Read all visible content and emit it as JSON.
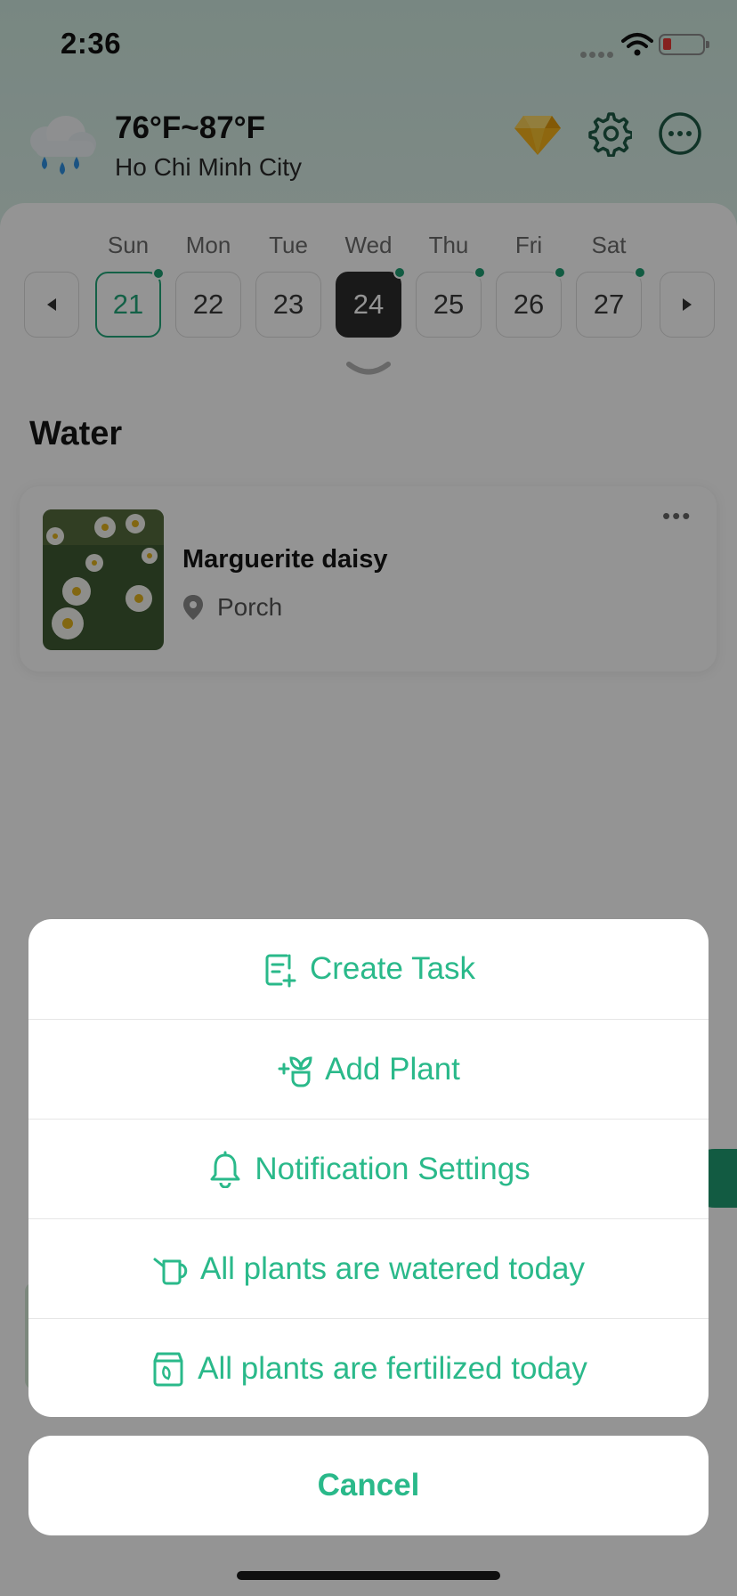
{
  "status_bar": {
    "time": "2:36"
  },
  "weather": {
    "temperature": "76°F~87°F",
    "city": "Ho Chi Minh City",
    "icon": "rain-cloud-icon"
  },
  "header_icons": [
    "premium-gem-icon",
    "settings-gear-icon",
    "more-options-icon"
  ],
  "calendar": {
    "days": [
      {
        "label": "Sun",
        "date": "21",
        "has_task": true,
        "state": "selected"
      },
      {
        "label": "Mon",
        "date": "22",
        "has_task": false,
        "state": "normal"
      },
      {
        "label": "Tue",
        "date": "23",
        "has_task": false,
        "state": "normal"
      },
      {
        "label": "Wed",
        "date": "24",
        "has_task": true,
        "state": "today"
      },
      {
        "label": "Thu",
        "date": "25",
        "has_task": true,
        "state": "normal"
      },
      {
        "label": "Fri",
        "date": "26",
        "has_task": true,
        "state": "normal"
      },
      {
        "label": "Sat",
        "date": "27",
        "has_task": true,
        "state": "normal"
      }
    ]
  },
  "section": {
    "title": "Water"
  },
  "plant_card": {
    "name": "Marguerite daisy",
    "location": "Porch",
    "more": "•••"
  },
  "action_sheet": {
    "items": [
      {
        "label": "Create Task",
        "icon": "create-task-icon"
      },
      {
        "label": "Add Plant",
        "icon": "add-plant-icon"
      },
      {
        "label": "Notification Settings",
        "icon": "bell-icon"
      },
      {
        "label": "All plants are watered today",
        "icon": "watering-can-icon"
      },
      {
        "label": "All plants are fertilized today",
        "icon": "fertilizer-bag-icon"
      }
    ],
    "cancel_label": "Cancel"
  },
  "colors": {
    "accent": "#2ab98a",
    "today_bg": "#2c2c2c",
    "task_dot": "#1f9d73"
  }
}
